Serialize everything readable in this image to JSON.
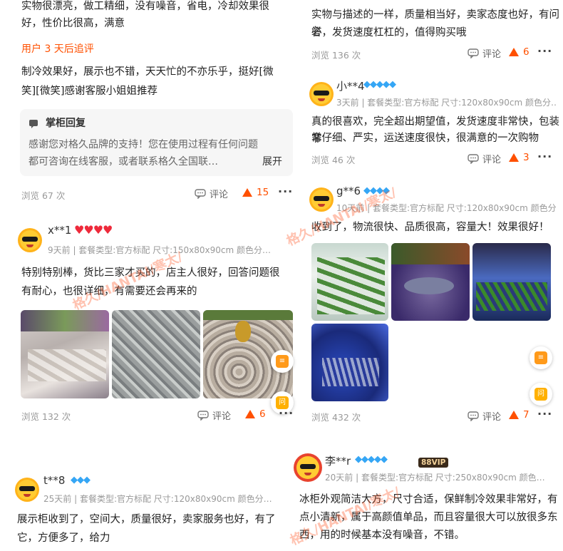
{
  "left": {
    "review1": {
      "text_line1": "实物很漂亮，做工精细，没有噪音，省电，冷却效果很",
      "text_line2": "好，性价比很高，满意",
      "followup_label": "用户 3 天后追评",
      "followup_line1": "制冷效果好，展示也不错，天天忙的不亦乐乎，挺好[微",
      "followup_line2": "笑][微笑]感谢客服小姐姐推荐",
      "reply_title": "掌柜回复",
      "reply_line1": "感谢您对格久品牌的支持！您在使用过程有任何问题",
      "reply_line2": "都可咨询在线客服，或者联系格久全国联…",
      "reply_expand": "展开",
      "views": "浏览 67 次",
      "comment": "评论",
      "likes": "15"
    },
    "review2": {
      "nick": "x**1",
      "badges": "♥♥♥♥",
      "meta": "9天前 | 套餐类型:官方标配 尺寸:150x80x90cm 颜色分…",
      "text_line1": "特别特别棒，货比三家才买的，店主人很好，回答问题很",
      "text_line2": "有耐心，也很详细，有需要还会再来的",
      "views": "浏览 132 次",
      "comment": "评论",
      "likes": "6"
    },
    "review3": {
      "nick": "t**8",
      "badges": "◆◆◆",
      "meta": "25天前 | 套餐类型:官方标配 尺寸:120x80x90cm 颜色分…",
      "text_line1": "展示柜收到了，空间大，质量很好，卖家服务也好，有了",
      "text_line2": "它，方便多了，给力"
    }
  },
  "right": {
    "review1": {
      "text_line1": "实物与描述的一样，质量相当好，卖家态度也好，有问必",
      "text_line2": "答，发货速度杠杠的，值得购买哦",
      "views": "浏览 136 次",
      "comment": "评论",
      "likes": "6"
    },
    "review2": {
      "nick": "小**4",
      "badges": "◆◆◆◆◆",
      "meta": "3天前 | 套餐类型:官方标配 尺寸:120x80x90cm 颜色分…",
      "text_line1": "真的很喜欢，完全超出期望值，发货速度非常快，包装非",
      "text_line2": "常仔细、严实，运送速度很快，很满意的一次购物",
      "views": "浏览 46 次",
      "comment": "评论",
      "likes": "3"
    },
    "review3": {
      "nick": "g**6",
      "badges": "◆◆◆◆",
      "meta": "10天前 | 套餐类型:官方标配 尺寸:120x80x90cm 颜色分…",
      "text_line1": "收到了，物流很快、品质很高，容量大！效果很好！",
      "views": "浏览 432 次",
      "comment": "评论",
      "likes": "7"
    },
    "review4": {
      "nick": "李**r",
      "badges": "◆◆◆◆◆",
      "vip": "88VIP",
      "meta": "20天前 | 套餐类型:官方标配 尺寸:250x80x90cm 颜色…",
      "text_line1": "冰柜外观简洁大方，尺寸合适，保鲜制冷效果非常好，有",
      "text_line2": "点小清新，属于高颜值单品，而且容量很大可以放很多东",
      "text_line3": "西，用的时候基本没有噪音，不错。"
    }
  },
  "float_buttons": {
    "ask_label": "问"
  },
  "watermark": "格久/HANTAI/寒太/"
}
